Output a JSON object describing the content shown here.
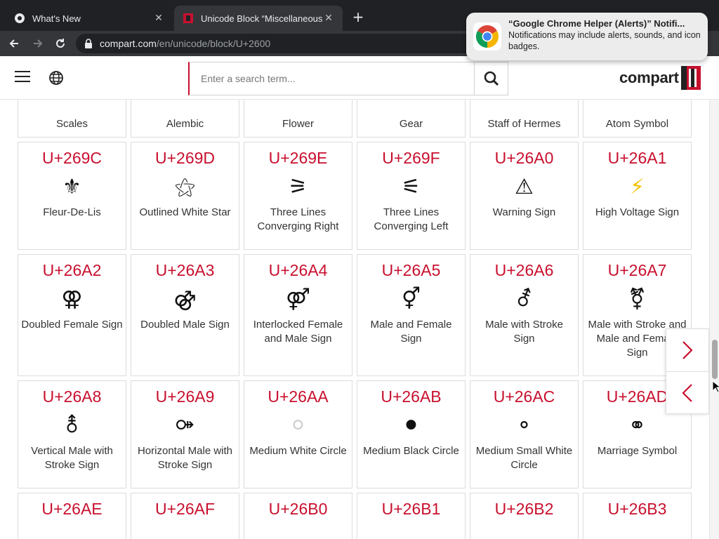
{
  "browser": {
    "tabs": [
      {
        "title": "What's New",
        "active": false
      },
      {
        "title": "Unicode Block “Miscellaneous",
        "active": true
      }
    ],
    "close_glyph": "✕",
    "new_tab_glyph": "+",
    "url_host": "compart.com",
    "url_path": "/en/unicode/block/U+2600"
  },
  "notification": {
    "title": "“Google Chrome Helper (Alerts)” Notifi...",
    "body": "Notifications may include alerts, sounds, and icon badges."
  },
  "header": {
    "search_placeholder": "Enter a search term...",
    "logo_text": "compart"
  },
  "top_row": [
    "Scales",
    "Alembic",
    "Flower",
    "Gear",
    "Staff of Hermes",
    "Atom Symbol"
  ],
  "rows": [
    [
      {
        "code": "U+269C",
        "glyph": "⚜",
        "name": "Fleur-De-Lis"
      },
      {
        "code": "U+269D",
        "glyph": "⚝",
        "name": "Outlined White Star"
      },
      {
        "code": "U+269E",
        "glyph": "⚞",
        "name": "Three Lines Converging Right"
      },
      {
        "code": "U+269F",
        "glyph": "⚟",
        "name": "Three Lines Converging Left"
      },
      {
        "code": "U+26A0",
        "glyph": "⚠",
        "name": "Warning Sign"
      },
      {
        "code": "U+26A1",
        "glyph": "⚡",
        "name": "High Voltage Sign"
      }
    ],
    [
      {
        "code": "U+26A2",
        "glyph": "⚢",
        "name": "Doubled Female Sign"
      },
      {
        "code": "U+26A3",
        "glyph": "⚣",
        "name": "Doubled Male Sign"
      },
      {
        "code": "U+26A4",
        "glyph": "⚤",
        "name": "Interlocked Female and Male Sign"
      },
      {
        "code": "U+26A5",
        "glyph": "⚥",
        "name": "Male and Female Sign"
      },
      {
        "code": "U+26A6",
        "glyph": "⚦",
        "name": "Male with Stroke Sign"
      },
      {
        "code": "U+26A7",
        "glyph": "⚧",
        "name": "Male with Stroke and Male and Female Sign"
      }
    ],
    [
      {
        "code": "U+26A8",
        "glyph": "⚨",
        "name": "Vertical Male with Stroke Sign"
      },
      {
        "code": "U+26A9",
        "glyph": "⚩",
        "name": "Horizontal Male with Stroke Sign"
      },
      {
        "code": "U+26AA",
        "glyph": "⚪",
        "name": "Medium White Circle"
      },
      {
        "code": "U+26AB",
        "glyph": "⚫",
        "name": "Medium Black Circle"
      },
      {
        "code": "U+26AC",
        "glyph": "⚬",
        "name": "Medium Small White Circle"
      },
      {
        "code": "U+26AD",
        "glyph": "⚭",
        "name": "Marriage Symbol"
      }
    ],
    [
      {
        "code": "U+26AE",
        "glyph": "",
        "name": ""
      },
      {
        "code": "U+26AF",
        "glyph": "",
        "name": ""
      },
      {
        "code": "U+26B0",
        "glyph": "",
        "name": ""
      },
      {
        "code": "U+26B1",
        "glyph": "",
        "name": ""
      },
      {
        "code": "U+26B2",
        "glyph": "",
        "name": ""
      },
      {
        "code": "U+26B3",
        "glyph": "",
        "name": ""
      }
    ]
  ],
  "colors": {
    "accent": "#c8102e",
    "chrome_dark": "#202124",
    "chrome_toolbar": "#35363a",
    "card_border": "#dcdcdc"
  },
  "icons": {
    "menu": "hamburger-icon",
    "language": "globe-icon",
    "search": "magnifier-icon",
    "next": "chevron-right-icon",
    "prev": "chevron-left-icon"
  }
}
